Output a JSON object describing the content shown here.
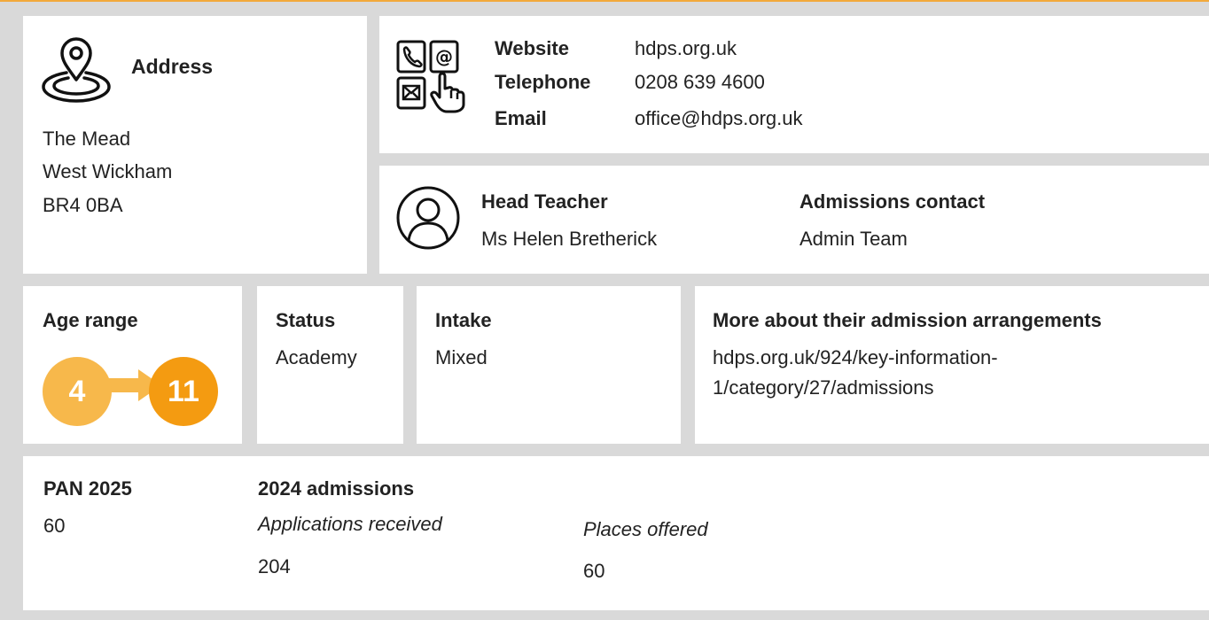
{
  "address": {
    "heading": "Address",
    "line1": "The Mead",
    "line2": "West Wickham",
    "line3": "BR4 0BA"
  },
  "contact": {
    "website_label": "Website",
    "website": "hdps.org.uk",
    "telephone_label": "Telephone",
    "telephone": "0208 639 4600",
    "email_label": "Email",
    "email": "office@hdps.org.uk"
  },
  "people": {
    "head_label": "Head Teacher",
    "head_name": "Ms Helen Bretherick",
    "admissions_label": "Admissions contact",
    "admissions_name": "Admin Team"
  },
  "age": {
    "label": "Age range",
    "from": "4",
    "to": "11"
  },
  "status": {
    "label": "Status",
    "value": "Academy"
  },
  "intake": {
    "label": "Intake",
    "value": "Mixed"
  },
  "arrangements": {
    "label": "More about their admission arrangements",
    "line1": "hdps.org.uk/924/key-information-",
    "line2": "1/category/27/admissions"
  },
  "pan": {
    "label": "PAN 2025",
    "value": "60"
  },
  "admissions_2024": {
    "label": "2024 admissions",
    "applications_label": "Applications received",
    "applications_value": "204",
    "offered_label": "Places offered",
    "offered_value": "60"
  },
  "colors": {
    "accent_light": "#f7b84b",
    "accent_dark": "#f49b11",
    "top_rule": "#f2a93b",
    "background": "#d9d9d9"
  },
  "icons": [
    "map-pin-icon",
    "contact-methods-icon",
    "person-icon",
    "arrow-right-icon"
  ]
}
